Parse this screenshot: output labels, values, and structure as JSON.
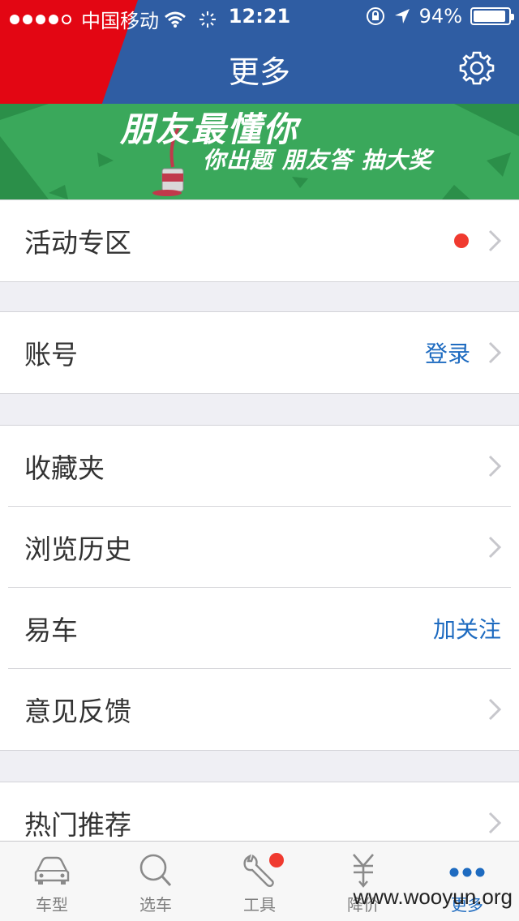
{
  "status": {
    "carrier": "中国移动",
    "time": "12:21",
    "battery": "94%",
    "battery_level": 0.94
  },
  "nav": {
    "title": "更多"
  },
  "banner": {
    "headline": "朋友最懂你",
    "subline": "你出题 朋友答 抽大奖",
    "background_color": "#3aa85b"
  },
  "groups": {
    "events": {
      "label": "活动专区"
    },
    "account": {
      "label": "账号",
      "action": "登录"
    },
    "main": {
      "favorites": "收藏夹",
      "history": "浏览历史",
      "yiche": "易车",
      "yiche_action": "加关注",
      "feedback": "意见反馈"
    },
    "hot": {
      "label": "热门推荐"
    }
  },
  "tabbar": {
    "items": [
      {
        "label": "车型",
        "icon": "car-icon"
      },
      {
        "label": "选车",
        "icon": "search-icon"
      },
      {
        "label": "工具",
        "icon": "wrench-icon"
      },
      {
        "label": "降价",
        "icon": "yuan-down-icon"
      },
      {
        "label": "更多",
        "icon": "more-dots-icon"
      }
    ]
  },
  "watermark": "www.wooyun.org",
  "colors": {
    "nav_blue": "#2f5da3",
    "brand_red": "#e30613",
    "link_blue": "#1e6bc0",
    "badge_red": "#f03a2f"
  }
}
